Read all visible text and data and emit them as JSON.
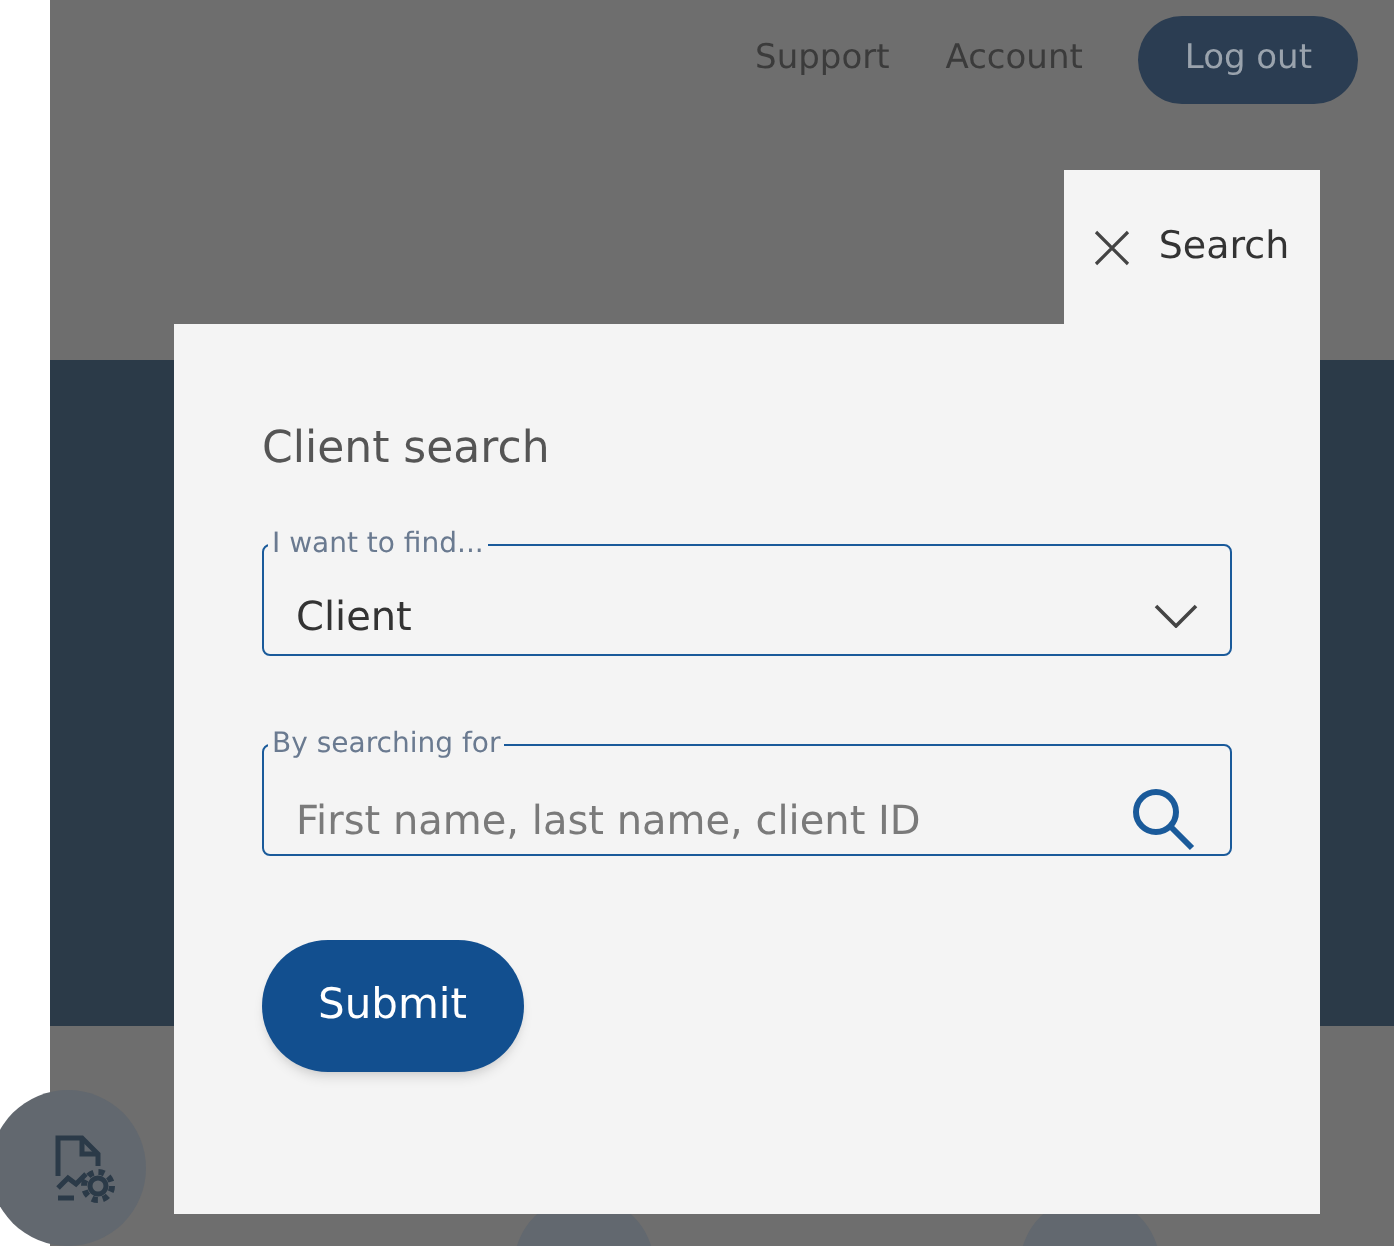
{
  "header": {
    "links": [
      "Support",
      "Account"
    ],
    "logout": "Log out"
  },
  "search_panel": {
    "tab": "Search",
    "title": "Client search",
    "find_field": {
      "label": "I want to find...",
      "value": "Client"
    },
    "query_field": {
      "label": "By searching for",
      "placeholder": "First name, last name, client ID"
    },
    "submit": "Submit"
  }
}
